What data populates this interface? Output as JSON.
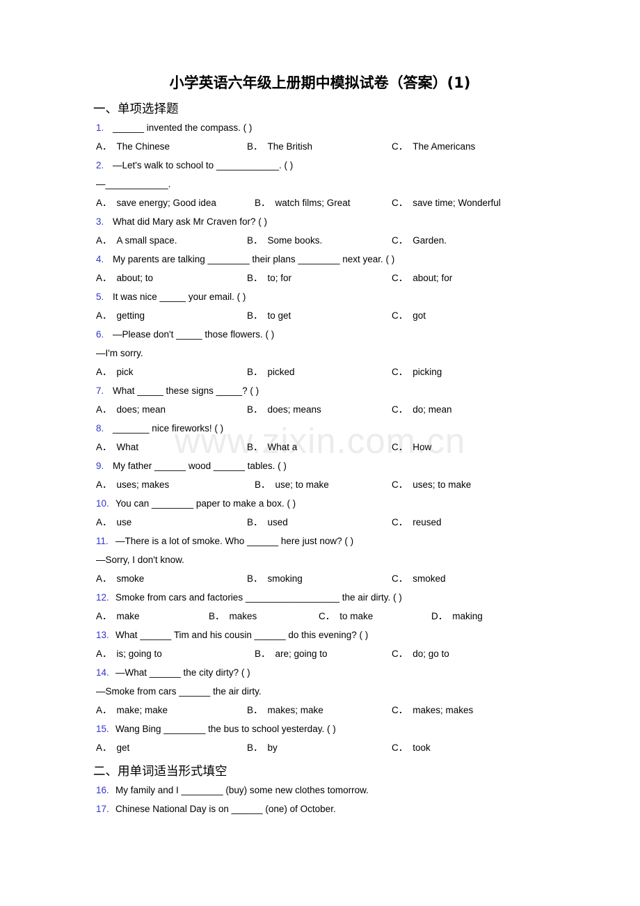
{
  "document": {
    "title": "小学英语六年级上册期中模拟试卷（答案）(1)",
    "watermark": "www.zixin.com.cn",
    "number_color": "#3333CC",
    "text_color": "#000000",
    "page_background": "#FFFFFF"
  },
  "sections": [
    {
      "heading": "一、单项选择题",
      "questions": [
        {
          "number": "1.",
          "stem": "______ invented the compass. (    )",
          "continuation": null,
          "option_labels": [
            "A．",
            "B．",
            "C．"
          ],
          "options": [
            "The Chinese",
            "The British",
            "The Americans"
          ],
          "columns": 3,
          "layout": "cols3"
        },
        {
          "number": "2.",
          "stem": "—Let's walk to school to ____________. (    )",
          "continuation": "—____________.",
          "option_labels": [
            "A．",
            "B．",
            "C．"
          ],
          "options": [
            "save energy; Good idea",
            "watch films; Great",
            "save time; Wonderful"
          ],
          "columns": 3,
          "layout": "cols3b"
        },
        {
          "number": "3.",
          "stem": "What did Mary ask Mr Craven for? (    )",
          "continuation": null,
          "option_labels": [
            "A．",
            "B．",
            "C．"
          ],
          "options": [
            "A small space.",
            "Some books.",
            "Garden."
          ],
          "columns": 3,
          "layout": "cols3"
        },
        {
          "number": "4.",
          "stem": "My parents are talking ________ their plans ________ next year. (    )",
          "continuation": null,
          "option_labels": [
            "A．",
            "B．",
            "C．"
          ],
          "options": [
            "about; to",
            "to; for",
            "about; for"
          ],
          "columns": 3,
          "layout": "cols3"
        },
        {
          "number": "5.",
          "stem": "It was nice _____ your email. (    )",
          "continuation": null,
          "option_labels": [
            "A．",
            "B．",
            "C．"
          ],
          "options": [
            "getting",
            "to get",
            "got"
          ],
          "columns": 3,
          "layout": "cols3"
        },
        {
          "number": "6.",
          "stem": "—Please don't _____ those flowers. (    )",
          "continuation": "—I'm sorry.",
          "option_labels": [
            "A．",
            "B．",
            "C．"
          ],
          "options": [
            "pick",
            "picked",
            "picking"
          ],
          "columns": 3,
          "layout": "cols3"
        },
        {
          "number": "7.",
          "stem": "What _____ these signs _____? (    )",
          "continuation": null,
          "option_labels": [
            "A．",
            "B．",
            "C．"
          ],
          "options": [
            "does; mean",
            "does; means",
            "do; mean"
          ],
          "columns": 3,
          "layout": "cols3"
        },
        {
          "number": "8.",
          "stem": "_______ nice fireworks! (    )",
          "continuation": null,
          "option_labels": [
            "A．",
            "B．",
            "C．"
          ],
          "options": [
            "What",
            "What a",
            "How"
          ],
          "columns": 3,
          "layout": "cols3"
        },
        {
          "number": "9.",
          "stem": "My father ______ wood ______ tables. (    )",
          "continuation": null,
          "option_labels": [
            "A．",
            "B．",
            "C．"
          ],
          "options": [
            "uses; makes",
            "use; to make",
            "uses; to make"
          ],
          "columns": 3,
          "layout": "cols3b"
        },
        {
          "number": "10.",
          "stem": "You can ________ paper to make a box. (    )",
          "continuation": null,
          "option_labels": [
            "A．",
            "B．",
            "C．"
          ],
          "options": [
            "use",
            "used",
            "reused"
          ],
          "columns": 3,
          "layout": "cols3"
        },
        {
          "number": "11.",
          "stem": "—There is a lot of smoke. Who ______ here just now? (    )",
          "continuation": "—Sorry, I don't know.",
          "option_labels": [
            "A．",
            "B．",
            "C．"
          ],
          "options": [
            "smoke",
            "smoking",
            "smoked"
          ],
          "columns": 3,
          "layout": "cols3"
        },
        {
          "number": "12.",
          "stem": "Smoke from cars and factories __________________ the air dirty. (    )",
          "continuation": null,
          "option_labels": [
            "A．",
            "B．",
            "C．",
            "D．"
          ],
          "options": [
            "make",
            "makes",
            "to make",
            "making"
          ],
          "columns": 4,
          "layout": "cols4"
        },
        {
          "number": "13.",
          "stem": "What ______ Tim and his cousin ______ do this evening? (    )",
          "continuation": null,
          "option_labels": [
            "A．",
            "B．",
            "C．"
          ],
          "options": [
            "is; going to",
            "are; going to",
            "do; go to"
          ],
          "columns": 3,
          "layout": "cols3b"
        },
        {
          "number": "14.",
          "stem": "—What ______ the city dirty? (    )",
          "continuation": "—Smoke from cars ______ the air dirty.",
          "option_labels": [
            "A．",
            "B．",
            "C．"
          ],
          "options": [
            "make; make",
            "makes; make",
            "makes; makes"
          ],
          "columns": 3,
          "layout": "cols3"
        },
        {
          "number": "15.",
          "stem": "Wang Bing ________ the bus to school yesterday. (    )",
          "continuation": null,
          "option_labels": [
            "A．",
            "B．",
            "C．"
          ],
          "options": [
            "get",
            "by",
            "took"
          ],
          "columns": 3,
          "layout": "cols3"
        }
      ]
    },
    {
      "heading": "二、用单词适当形式填空",
      "questions": [
        {
          "number": "16.",
          "stem": "My family and I ________ (buy) some new clothes tomorrow.",
          "continuation": null,
          "option_labels": [],
          "options": [],
          "columns": 0,
          "layout": "none"
        },
        {
          "number": "17.",
          "stem": "Chinese National Day is on ______ (one) of October.",
          "continuation": null,
          "option_labels": [],
          "options": [],
          "columns": 0,
          "layout": "none"
        }
      ]
    }
  ]
}
